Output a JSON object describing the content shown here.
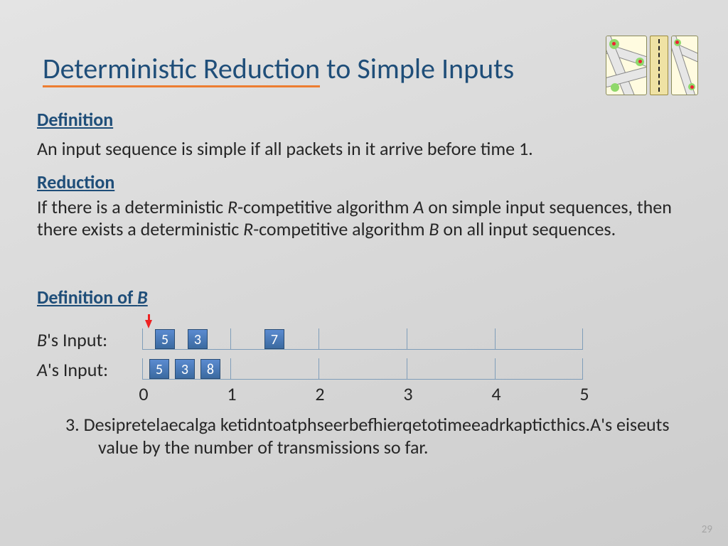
{
  "title": "Deterministic Reduction to Simple Inputs",
  "sections": {
    "definition_h": "Definition",
    "definition_t": "An input sequence is simple if all packets in it arrive before time 1.",
    "reduction_h": "Reduction",
    "reduction_t1": "If there is a deterministic ",
    "reduction_R": "R",
    "reduction_t2": "-competitive algorithm ",
    "reduction_A": "A",
    "reduction_t3": " on simple input sequences, then there exists a deterministic ",
    "reduction_R2": "R",
    "reduction_t4": "-competitive algorithm ",
    "reduction_B": "B",
    "reduction_t5": " on all input sequences.",
    "defb_h_pre": "Definition of ",
    "defb_h_B": "B"
  },
  "b_label_pre": "B",
  "b_label_suf": "'s Input:",
  "a_label_pre": "A",
  "a_label_suf": "'s Input:",
  "b_packets": [
    "5",
    "3",
    "7"
  ],
  "a_packets": [
    "5",
    "3",
    "8"
  ],
  "axis": [
    "0",
    "1",
    "2",
    "3",
    "4",
    "5"
  ],
  "steps": {
    "garble_line1": "3.   Desipretelaecalga ketidntoatphseerbefhierqetotimeeadrkapticthics.A's eiseuts",
    "line2": "value by the number of transmissions so far."
  },
  "pagenum": "29"
}
